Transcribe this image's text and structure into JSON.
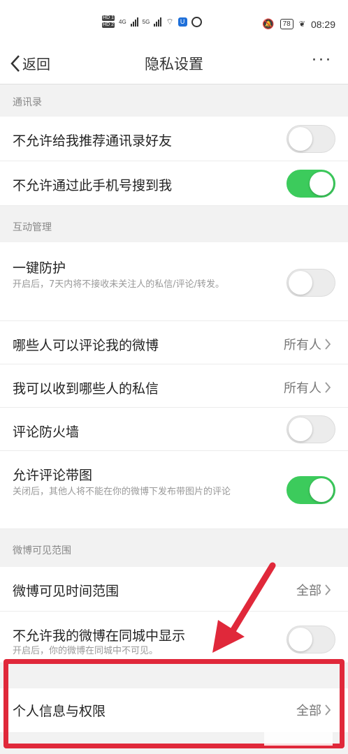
{
  "status_bar": {
    "sim1": "HD 1",
    "sim2": "HD 2",
    "net1": "4G",
    "net2": "5G",
    "battery": "78",
    "time": "08:29"
  },
  "nav": {
    "back_label": "返回",
    "title": "隐私设置",
    "more_label": "···"
  },
  "sections": {
    "contacts": {
      "header": "通讯录",
      "rows": [
        {
          "label": "不允许给我推荐通讯录好友",
          "toggle": "off"
        },
        {
          "label": "不允许通过此手机号搜到我",
          "toggle": "on"
        }
      ]
    },
    "interaction": {
      "header": "互动管理",
      "one_click": {
        "label": "一键防护",
        "sub": "开启后，7天内将不接收未关注人的私信/评论/转发。",
        "toggle": "off"
      },
      "who_comment": {
        "label": "哪些人可以评论我的微博",
        "value": "所有人"
      },
      "who_message": {
        "label": "我可以收到哪些人的私信",
        "value": "所有人"
      },
      "firewall": {
        "label": "评论防火墙",
        "toggle": "off"
      },
      "allow_images": {
        "label": "允许评论带图",
        "sub": "关闭后，其他人将不能在你的微博下发布带图片的评论",
        "toggle": "on"
      }
    },
    "visibility": {
      "header": "微博可见范围",
      "time_range": {
        "label": "微博可见时间范围",
        "value": "全部"
      },
      "same_city": {
        "label": "不允许我的微博在同城中显示",
        "sub": "开启后，你的微博在同城中不可见。",
        "toggle": "off"
      }
    },
    "personal": {
      "info": {
        "label": "个人信息与权限",
        "value": "全部"
      }
    }
  },
  "colors": {
    "toggle_on": "#3ccb5c",
    "highlight": "#e0283a"
  }
}
